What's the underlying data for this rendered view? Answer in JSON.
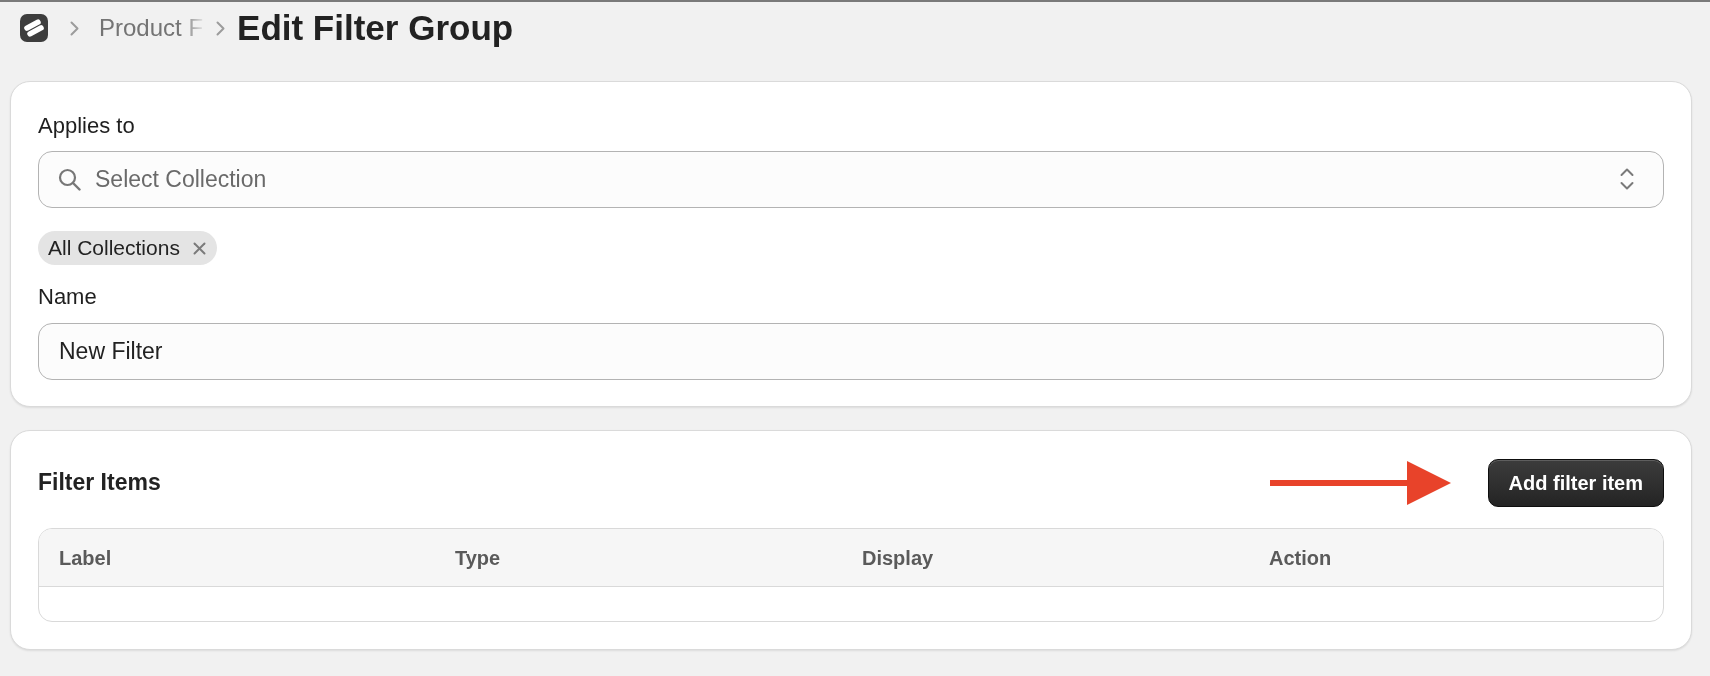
{
  "breadcrumb": {
    "items": [
      {
        "label": "Product F"
      }
    ],
    "current": "Edit Filter Group"
  },
  "applies_to": {
    "label": "Applies to",
    "placeholder": "Select Collection",
    "tags": [
      {
        "label": "All Collections"
      }
    ]
  },
  "name_field": {
    "label": "Name",
    "value": "New Filter"
  },
  "filter_items": {
    "title": "Filter Items",
    "add_button": "Add filter item",
    "table": {
      "columns": [
        "Label",
        "Type",
        "Display",
        "Action"
      ]
    }
  }
}
